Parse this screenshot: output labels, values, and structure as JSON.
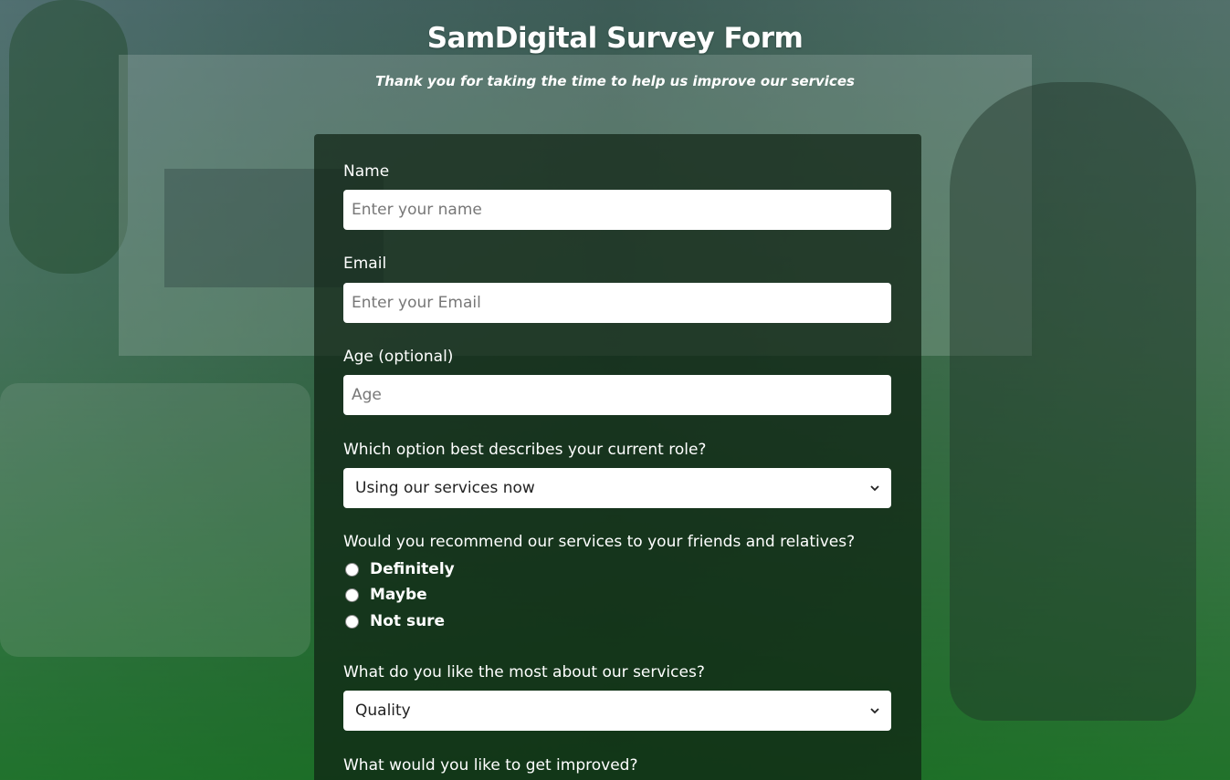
{
  "header": {
    "title": "SamDigital Survey Form",
    "subtitle": "Thank you for taking the time to help us improve our services"
  },
  "form": {
    "name": {
      "label": "Name",
      "value": "",
      "placeholder": "Enter your name"
    },
    "email": {
      "label": "Email",
      "value": "",
      "placeholder": "Enter your Email"
    },
    "age": {
      "label": "Age (optional)",
      "value": "",
      "placeholder": "Age"
    },
    "role": {
      "label": "Which option best describes your current role?",
      "selected": "Using our services now"
    },
    "recommend": {
      "label": "Would you recommend our services to your friends and relatives?",
      "options": [
        {
          "label": "Definitely",
          "checked": false
        },
        {
          "label": "Maybe",
          "checked": false
        },
        {
          "label": "Not sure",
          "checked": false
        }
      ]
    },
    "like_most": {
      "label": "What do you like the most about our services?",
      "selected": "Quality"
    },
    "improve": {
      "label": "What would you like to get improved?"
    }
  },
  "icons": {
    "select_arrow": "chevron-down-icon",
    "radio": "radio-unchecked-icon"
  }
}
